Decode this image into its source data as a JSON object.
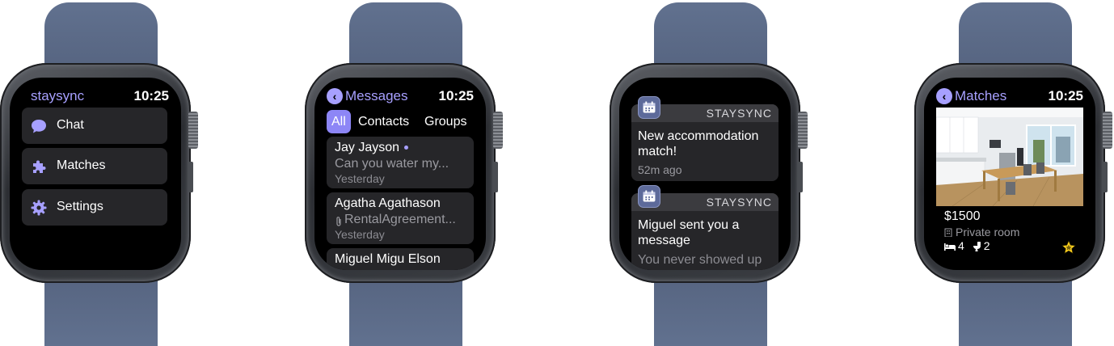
{
  "watch1": {
    "app_title": "staysync",
    "time": "10:25",
    "menu": [
      {
        "label": "Chat",
        "icon": "chat-bubble-icon"
      },
      {
        "label": "Matches",
        "icon": "puzzle-piece-icon"
      },
      {
        "label": "Settings",
        "icon": "gear-icon"
      }
    ]
  },
  "watch2": {
    "back_label": "Messages",
    "time": "10:25",
    "tabs": [
      "All",
      "Contacts",
      "Groups"
    ],
    "active_tab": "All",
    "messages": [
      {
        "name": "Jay Jayson",
        "preview": "Can you water my...",
        "time": "Yesterday",
        "unread": true
      },
      {
        "name": "Agatha Agathason",
        "preview": "RentalAgreement...",
        "time": "Yesterday",
        "attachment": true
      },
      {
        "name": "Miguel Migu Elson",
        "preview": "",
        "time": ""
      }
    ]
  },
  "watch3": {
    "notifications": [
      {
        "app": "STAYSYNC",
        "body": "New accommodation match!",
        "time": "52m ago"
      },
      {
        "app": "STAYSYNC",
        "body": "Miguel sent you a message",
        "preview": "You never showed up"
      }
    ]
  },
  "watch4": {
    "back_label": "Matches",
    "time": "10:25",
    "price": "$1500",
    "room_type": "Private room",
    "beds": "4",
    "baths": "2",
    "accent": "#a7a0ff",
    "star_color": "#ffd21f"
  }
}
